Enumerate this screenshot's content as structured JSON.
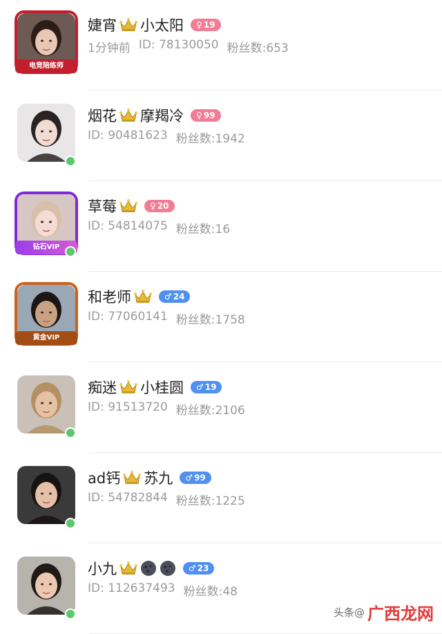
{
  "users": [
    {
      "name_left": "婕宵",
      "name_right": "小太阳",
      "gender_symbol": "♀",
      "age": "19",
      "gender": "female",
      "time": "1分钟前",
      "id": "ID: 78130050",
      "fans": "粉丝数:653",
      "frame": "red",
      "frame_label": "电竞陪练师",
      "online": false,
      "bg": "#6d5a55",
      "skin": "#e8c7b5",
      "hair": "#2a1d17"
    },
    {
      "name_left": "烟花",
      "name_right": "摩羯冷",
      "gender_symbol": "♀",
      "age": "99",
      "gender": "female",
      "time": "",
      "id": "ID: 90481623",
      "fans": "粉丝数:1942",
      "frame": "",
      "frame_label": "",
      "online": true,
      "bg": "#e9e6e8",
      "skin": "#f1dcd4",
      "hair": "#2b2323"
    },
    {
      "name_left": "草莓",
      "name_right": "",
      "gender_symbol": "♀",
      "age": "20",
      "gender": "female",
      "time": "",
      "id": "ID: 54814075",
      "fans": "粉丝数:16",
      "frame": "purple",
      "frame_label": "钻石VIP",
      "online": true,
      "bg": "#d7c7c2",
      "skin": "#f4dbd3",
      "hair": "#d9bfa8"
    },
    {
      "name_left": "和老师",
      "name_right": "",
      "gender_symbol": "♂",
      "age": "24",
      "gender": "male",
      "time": "",
      "id": "ID: 77060141",
      "fans": "粉丝数:1758",
      "frame": "orange",
      "frame_label": "黄金VIP",
      "online": false,
      "bg": "#9aa7b4",
      "skin": "#c9a283",
      "hair": "#1b1714"
    },
    {
      "name_left": "痴迷",
      "name_right": "小桂圆",
      "gender_symbol": "♂",
      "age": "19",
      "gender": "male",
      "time": "",
      "id": "ID: 91513720",
      "fans": "粉丝数:2106",
      "frame": "",
      "frame_label": "",
      "online": true,
      "bg": "#c9c1b8",
      "skin": "#e6c2a5",
      "hair": "#b59063"
    },
    {
      "name_left": "ad钙",
      "name_right": "苏九",
      "gender_symbol": "♂",
      "age": "99",
      "gender": "male",
      "time": "",
      "id": "ID: 54782844",
      "fans": "粉丝数:1225",
      "frame": "",
      "frame_label": "",
      "online": true,
      "bg": "#3b3a3a",
      "skin": "#e3c0a7",
      "hair": "#171313"
    },
    {
      "name_left": "小九",
      "name_right": "",
      "gender_symbol": "♂",
      "age": "23",
      "gender": "male",
      "time": "",
      "id": "ID: 112637493",
      "fans": "粉丝数:48",
      "frame": "",
      "frame_label": "",
      "online": true,
      "bg": "#b7b3ad",
      "skin": "#ecc8b0",
      "hair": "#1f1a17",
      "orbs": 2
    }
  ],
  "watermark": {
    "prefix": "头条@",
    "brand": "广西龙网"
  },
  "colors": {
    "female": "#f27c93",
    "male": "#4f90f0",
    "online": "#5ac86b",
    "meta": "#9a9a9a"
  }
}
